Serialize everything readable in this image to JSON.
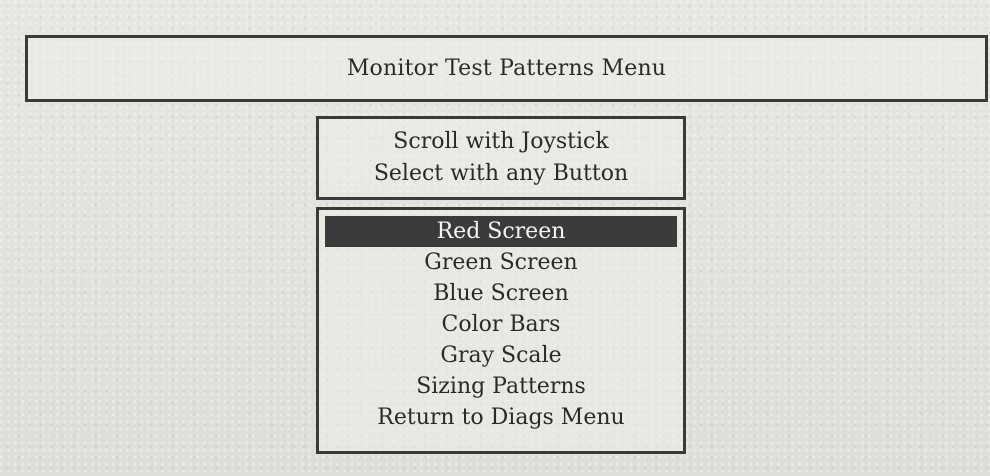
{
  "header": {
    "title": "Monitor Test Patterns Menu"
  },
  "instructions": {
    "line1": "Scroll with Joystick",
    "line2": "Select with any Button"
  },
  "menu": {
    "selected_index": 0,
    "items": [
      {
        "label": "Red Screen"
      },
      {
        "label": "Green Screen"
      },
      {
        "label": "Blue Screen"
      },
      {
        "label": "Color Bars"
      },
      {
        "label": "Gray Scale"
      },
      {
        "label": "Sizing Patterns"
      },
      {
        "label": "Return to Diags Menu"
      }
    ]
  },
  "colors": {
    "background": "#e2e2de",
    "border": "#3a3a3a",
    "highlight": "#3b3b3b",
    "highlight_text": "#f4f4f0"
  }
}
